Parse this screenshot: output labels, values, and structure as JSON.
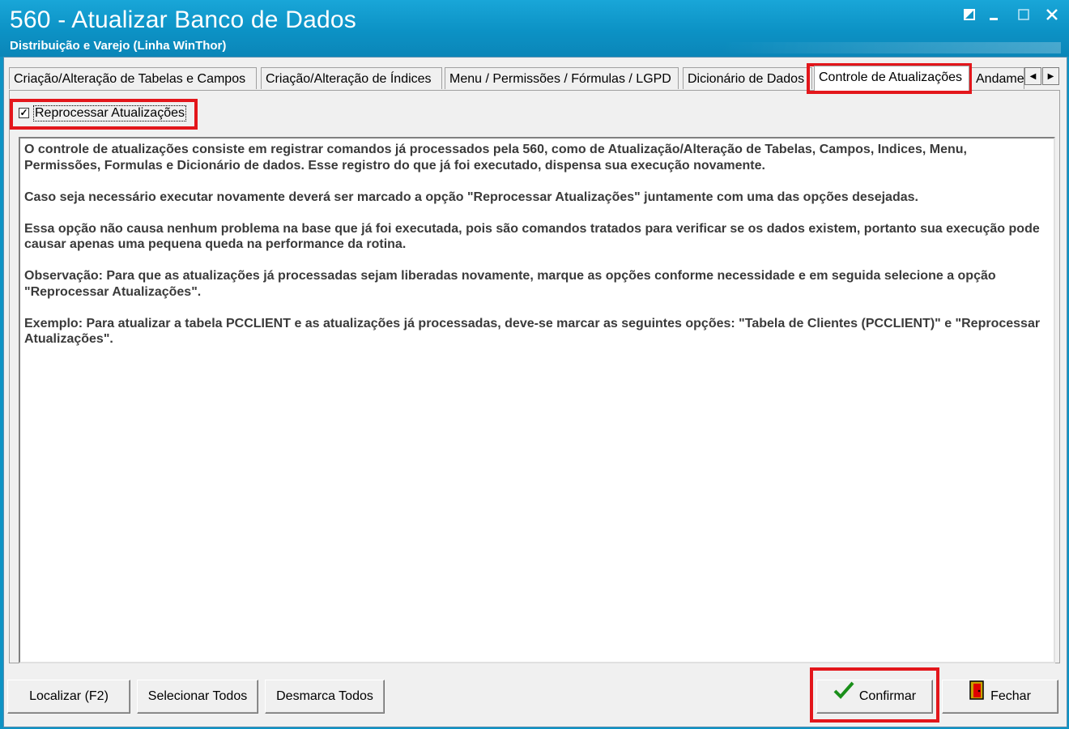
{
  "window": {
    "title": "560 - Atualizar Banco de Dados",
    "subtitle": "Distribuição e Varejo (Linha WinThor)",
    "controls": [
      "restore-icon",
      "minimize-icon",
      "maximize-icon",
      "close-icon"
    ]
  },
  "tabs": [
    {
      "label": "Criação/Alteração de Tabelas e Campos"
    },
    {
      "label": "Criação/Alteração de Índices"
    },
    {
      "label": "Menu / Permissões / Fórmulas / LGPD"
    },
    {
      "label": "Dicionário de Dados"
    },
    {
      "label": "Controle de Atualizações",
      "active": true
    },
    {
      "label": "Andame"
    }
  ],
  "checkbox": {
    "label": "Reprocessar Atualizações",
    "checked": true
  },
  "memo": {
    "p1": "O controle de atualizações consiste em registrar comandos já processados pela 560, como de Atualização/Alteração de Tabelas, Campos, Indices, Menu, Permissões, Formulas e Dicionário de dados. Esse registro do que já foi executado, dispensa sua execução novamente.",
    "p2": "Caso seja necessário executar novamente deverá ser marcado a opção \"Reprocessar Atualizações\" juntamente com uma das opções desejadas.",
    "p3": "Essa opção não causa nenhum problema na base que já foi executada, pois são comandos tratados para verificar se os dados existem, portanto sua execução pode causar apenas uma pequena queda na performance da rotina.",
    "p4": "Observação: Para que as atualizações já processadas sejam liberadas novamente, marque as opções conforme necessidade e em seguida selecione a opção \"Reprocessar Atualizações\".",
    "p5": "Exemplo: Para atualizar a tabela PCCLIENT e as atualizações já processadas, deve-se marcar as seguintes opções: \"Tabela de Clientes (PCCLIENT)\" e \"Reprocessar Atualizações\"."
  },
  "buttons": {
    "localizar": "Localizar (F2)",
    "selecionar": "Selecionar Todos",
    "desmarca": "Desmarca Todos",
    "confirmar": "Confirmar",
    "fechar": "Fechar"
  },
  "highlight_color": "#e3161b"
}
